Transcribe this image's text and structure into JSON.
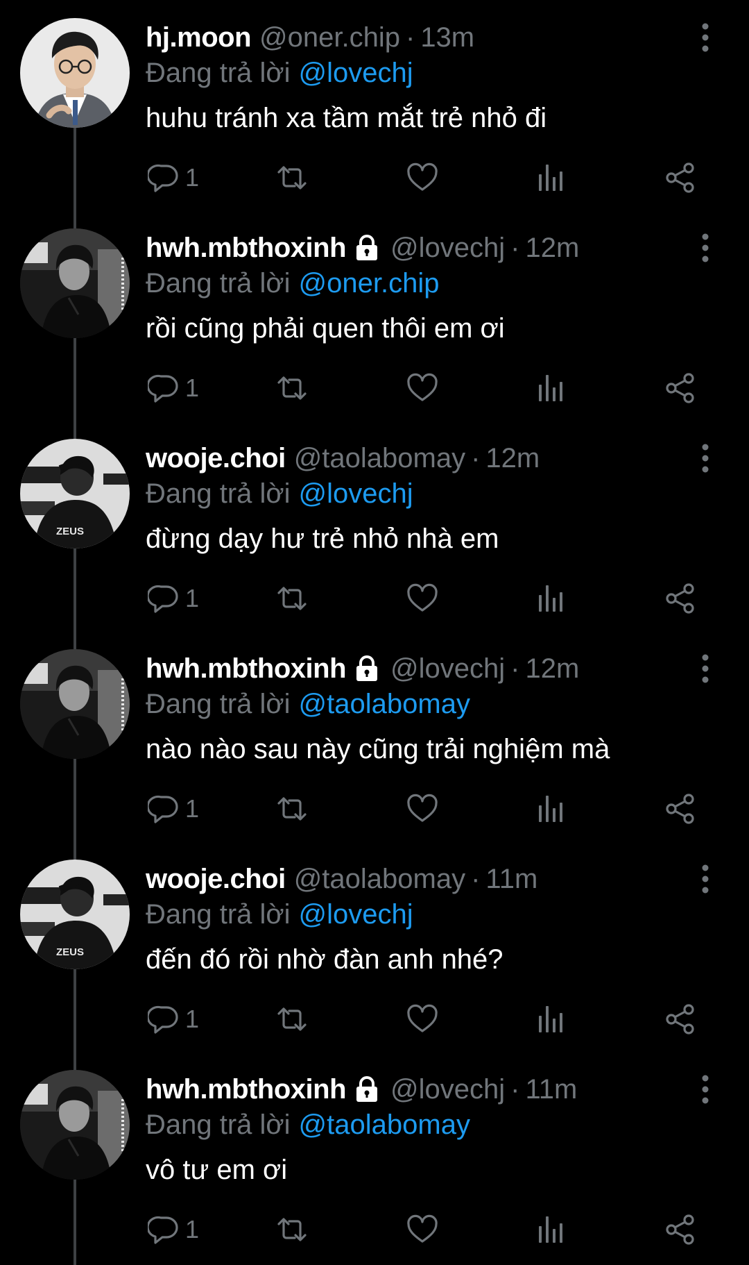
{
  "colors": {
    "background": "#000000",
    "text": "#ffffff",
    "secondary": "#71767b",
    "mention": "#1d9bf0",
    "thread_line": "#3e4144"
  },
  "labels": {
    "reply_prefix": "Đang trả lời",
    "separator": "·"
  },
  "icons": {
    "more": "more-vertical-icon",
    "reply": "reply-bubble-icon",
    "retweet": "retweet-icon",
    "like": "heart-icon",
    "views": "views-chart-icon",
    "share": "share-icon",
    "lock": "lock-icon"
  },
  "tweets": [
    {
      "name": "hj.moon",
      "protected": false,
      "handle": "@oner.chip",
      "time": "13m",
      "reply_to": "@lovechj",
      "text": "huhu tránh xa tầm mắt trẻ nhỏ đi",
      "reply_count": "1",
      "avatar": "glasses-portrait"
    },
    {
      "name": "hwh.mbthoxinh",
      "protected": true,
      "handle": "@lovechj",
      "time": "12m",
      "reply_to": "@oner.chip",
      "text": "rồi cũng phải quen thôi em ơi",
      "reply_count": "1",
      "avatar": "monochrome-player"
    },
    {
      "name": "wooje.choi",
      "protected": false,
      "handle": "@taolabomay",
      "time": "12m",
      "reply_to": "@lovechj",
      "text": "đừng dạy hư trẻ nhỏ nhà em",
      "reply_count": "1",
      "avatar": "zeus-jersey"
    },
    {
      "name": "hwh.mbthoxinh",
      "protected": true,
      "handle": "@lovechj",
      "time": "12m",
      "reply_to": "@taolabomay",
      "text": "nào nào sau này cũng trải nghiệm mà",
      "reply_count": "1",
      "avatar": "monochrome-player"
    },
    {
      "name": "wooje.choi",
      "protected": false,
      "handle": "@taolabomay",
      "time": "11m",
      "reply_to": "@lovechj",
      "text": "đến đó rồi nhờ đàn anh nhé?",
      "reply_count": "1",
      "avatar": "zeus-jersey"
    },
    {
      "name": "hwh.mbthoxinh",
      "protected": true,
      "handle": "@lovechj",
      "time": "11m",
      "reply_to": "@taolabomay",
      "text": "vô tư em ơi",
      "reply_count": "1",
      "avatar": "monochrome-player"
    }
  ],
  "zeus_logo_text": "ZEUS"
}
